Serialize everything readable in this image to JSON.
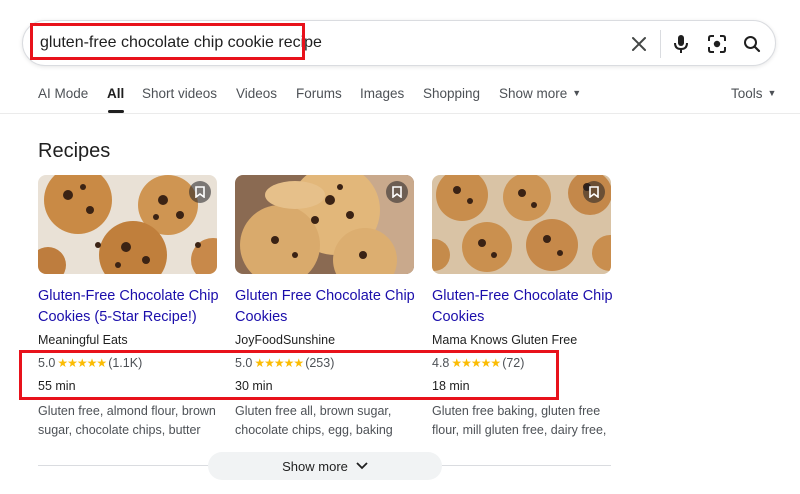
{
  "search": {
    "query": "gluten-free chocolate chip cookie recipe",
    "icons": [
      "clear-icon",
      "microphone-icon",
      "camera-lens-icon",
      "search-icon"
    ]
  },
  "tabs": [
    {
      "label": "AI Mode"
    },
    {
      "label": "All",
      "active": true
    },
    {
      "label": "Short videos"
    },
    {
      "label": "Videos"
    },
    {
      "label": "Forums"
    },
    {
      "label": "Images"
    },
    {
      "label": "Shopping"
    },
    {
      "label": "Show more"
    }
  ],
  "tools_label": "Tools",
  "section_title": "Recipes",
  "recipes": [
    {
      "title": "Gluten-Free Chocolate Chip Cookies (5-Star Recipe!)",
      "source": "Meaningful Eats",
      "rating": "5.0",
      "stars": "★★★★★",
      "reviews": "(1.1K)",
      "time": "55 min",
      "description": "Gluten free, almond flour, brown sugar, chocolate chips, butter"
    },
    {
      "title": "Gluten Free Chocolate Chip Cookies",
      "source": "JoyFoodSunshine",
      "rating": "5.0",
      "stars": "★★★★★",
      "reviews": "(253)",
      "time": "30 min",
      "description": "Gluten free all, brown sugar, chocolate chips, egg, baking"
    },
    {
      "title": "Gluten-Free Chocolate Chip Cookies",
      "source": "Mama Knows Gluten Free",
      "rating": "4.8",
      "stars": "★★★★★",
      "reviews": "(72)",
      "time": "18 min",
      "description": "Gluten free baking, gluten free flour, mill gluten free, dairy free,"
    }
  ],
  "show_more_label": "Show more",
  "colors": {
    "link": "#1a0dab",
    "star": "#fbbc04",
    "highlight": "#e8121b"
  }
}
